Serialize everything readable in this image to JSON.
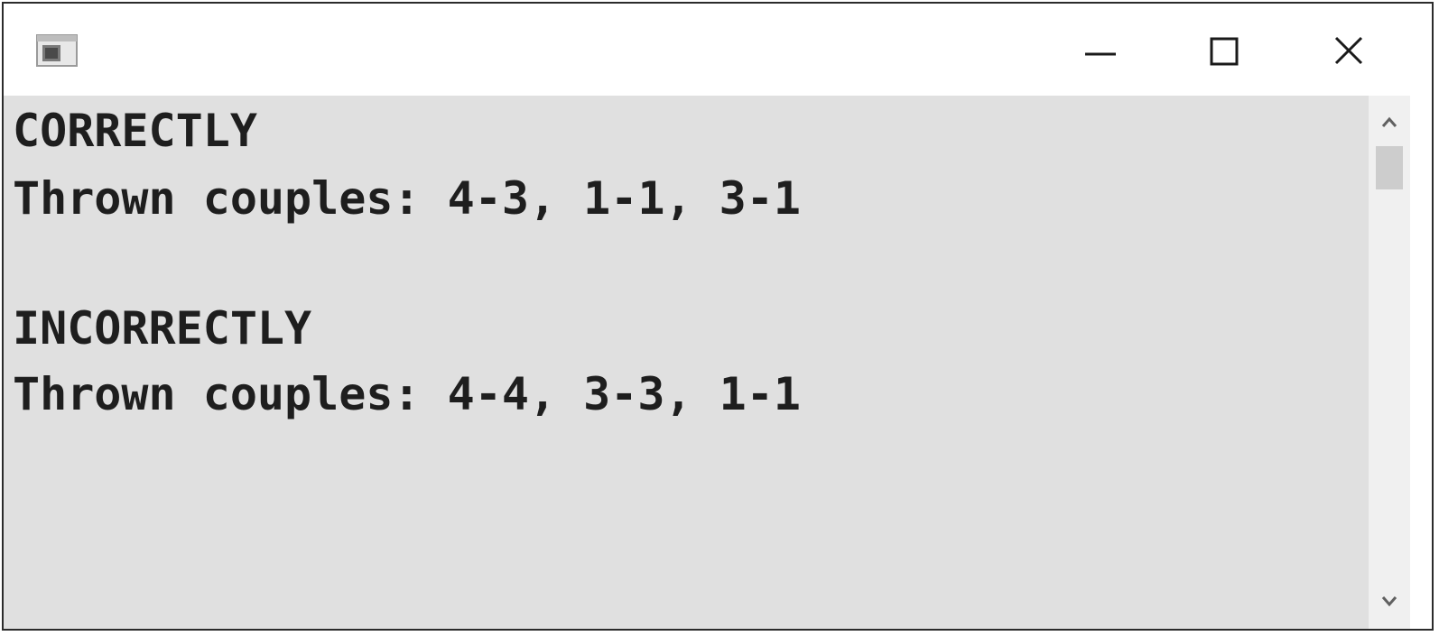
{
  "window": {
    "icons": {
      "app": "console-app-icon",
      "minimize": "minimize-icon",
      "maximize": "maximize-icon",
      "close": "close-icon"
    }
  },
  "console": {
    "lines": [
      "CORRECTLY",
      "Thrown couples: 4-3, 1-1, 3-1",
      "",
      "INCORRECTLY",
      "Thrown couples: 4-4, 3-3, 1-1"
    ]
  },
  "scrollbar": {
    "icons": {
      "up": "chevron-up-icon",
      "down": "chevron-down-icon"
    }
  },
  "colors": {
    "console_bg": "#e0e0e0",
    "text": "#1e1e1e",
    "titlebar_bg": "#ffffff"
  }
}
